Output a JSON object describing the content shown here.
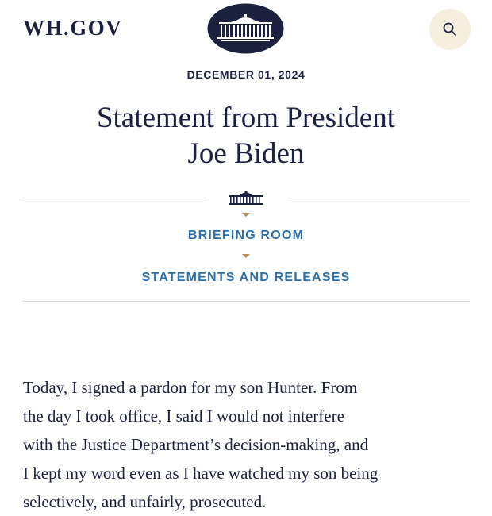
{
  "header": {
    "logo_text": "WH.GOV",
    "seal_icon": "white-house-seal-icon",
    "search_icon": "search-icon",
    "colors": {
      "navy": "#1c2140",
      "search_bg": "#f6efe0",
      "link_blue": "#2e6fa6",
      "arrow_gold": "#b38a5e"
    }
  },
  "article": {
    "date": "DECEMBER 01, 2024",
    "title_lines": [
      "Statement from President",
      "Joe Biden"
    ],
    "divider_icon": "white-house-icon",
    "breadcrumbs": [
      "BRIEFING ROOM",
      "STATEMENTS AND RELEASES"
    ],
    "body_lines": [
      "Today, I signed a pardon for my son Hunter. From",
      "the day I took office, I said I would not interfere",
      "with the Justice Department’s decision-making, and",
      "I kept my word even as I have watched my son being",
      "selectively, and unfairly, prosecuted."
    ]
  }
}
